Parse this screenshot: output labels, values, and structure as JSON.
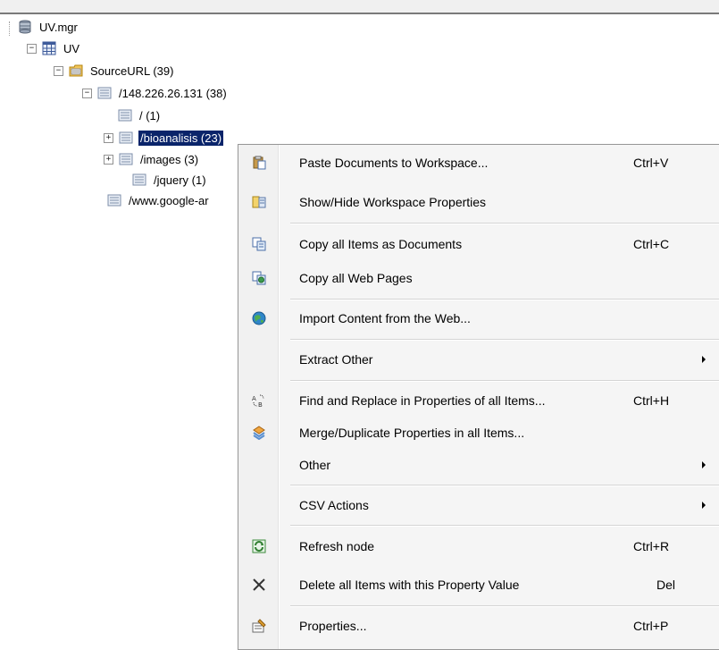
{
  "tree": {
    "root": {
      "label": "UV.mgr",
      "icon": "database-icon"
    },
    "nodes": [
      {
        "label": "UV",
        "expander": "−",
        "icon": "table-icon"
      },
      {
        "label": "SourceURL (39)",
        "expander": "−",
        "icon": "folder-icon"
      },
      {
        "label": "/148.226.26.131 (38)",
        "expander": "−",
        "icon": "list-icon"
      },
      {
        "label": "/ (1)",
        "expander": "",
        "icon": "list-icon"
      },
      {
        "label": "/bioanalisis (23)",
        "expander": "+",
        "icon": "list-icon"
      },
      {
        "label": "/images (3)",
        "expander": "+",
        "icon": "list-icon"
      },
      {
        "label": "/jquery (1)",
        "expander": "",
        "icon": "list-icon"
      },
      {
        "label": "/www.google-ar",
        "expander": "",
        "icon": "list-icon"
      }
    ]
  },
  "menu": {
    "items": [
      {
        "label": "Paste Documents to Workspace...",
        "shortcut": "Ctrl+V",
        "icon": "paste-icon"
      },
      {
        "label": "Show/Hide Workspace Properties",
        "shortcut": "",
        "icon": "workspace-properties-icon"
      },
      {
        "label": "Copy all Items as Documents",
        "shortcut": "Ctrl+C",
        "icon": "copy-documents-icon"
      },
      {
        "label": "Copy all Web Pages",
        "shortcut": "",
        "icon": "copy-web-pages-icon"
      },
      {
        "label": "Import Content from the Web...",
        "shortcut": "",
        "icon": "globe-icon"
      },
      {
        "label": "Extract Other",
        "shortcut": "",
        "icon": "",
        "submenu": true
      },
      {
        "label": "Find and Replace in Properties of all Items...",
        "shortcut": "Ctrl+H",
        "icon": "find-replace-icon"
      },
      {
        "label": "Merge/Duplicate Properties in all Items...",
        "shortcut": "",
        "icon": "merge-icon"
      },
      {
        "label": "Other",
        "shortcut": "",
        "icon": "",
        "submenu": true
      },
      {
        "label": "CSV Actions",
        "shortcut": "",
        "icon": "",
        "submenu": true
      },
      {
        "label": "Refresh node",
        "shortcut": "Ctrl+R",
        "icon": "refresh-icon"
      },
      {
        "label": "Delete all Items with this Property Value",
        "shortcut": "Del",
        "icon": "delete-icon"
      },
      {
        "label": "Properties...",
        "shortcut": "Ctrl+P",
        "icon": "properties-icon"
      }
    ]
  },
  "colors": {
    "selection": "#0a246a",
    "menu_bg": "#f5f5f5",
    "separator": "#d4d4d4"
  }
}
